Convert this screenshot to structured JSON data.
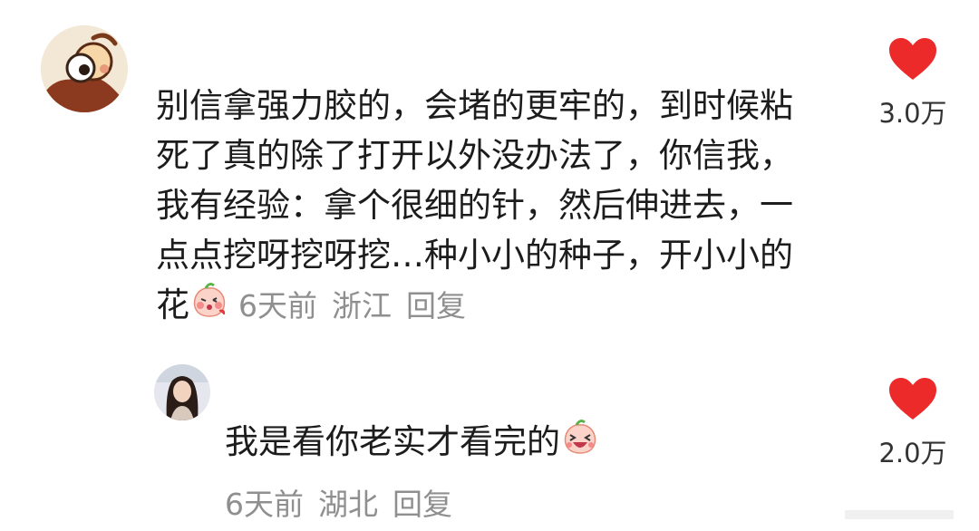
{
  "comments": [
    {
      "text": "别信拿强力胶的，会堵的更牢的，到时候粘死了真的除了打开以外没办法了，你信我，我有经验：拿个很细的针，然后伸进去，一点点挖呀挖呀挖…种小小的种子，开小小的花",
      "time": "6天前",
      "location": "浙江",
      "reply_label": "回复",
      "likes": "3.0万",
      "emoji": "blushing-peach-emoji",
      "avatar": "cartoon-avatar"
    },
    {
      "text": "我是看你老实才看完的",
      "time": "6天前",
      "location": "湖北",
      "reply_label": "回复",
      "likes": "2.0万",
      "emoji": "laughing-peach-emoji",
      "avatar": "photo-avatar"
    }
  ],
  "colors": {
    "like_heart": "#ec2a2a",
    "meta_text": "#8f8f8f",
    "body_text": "#1c1c1c"
  }
}
